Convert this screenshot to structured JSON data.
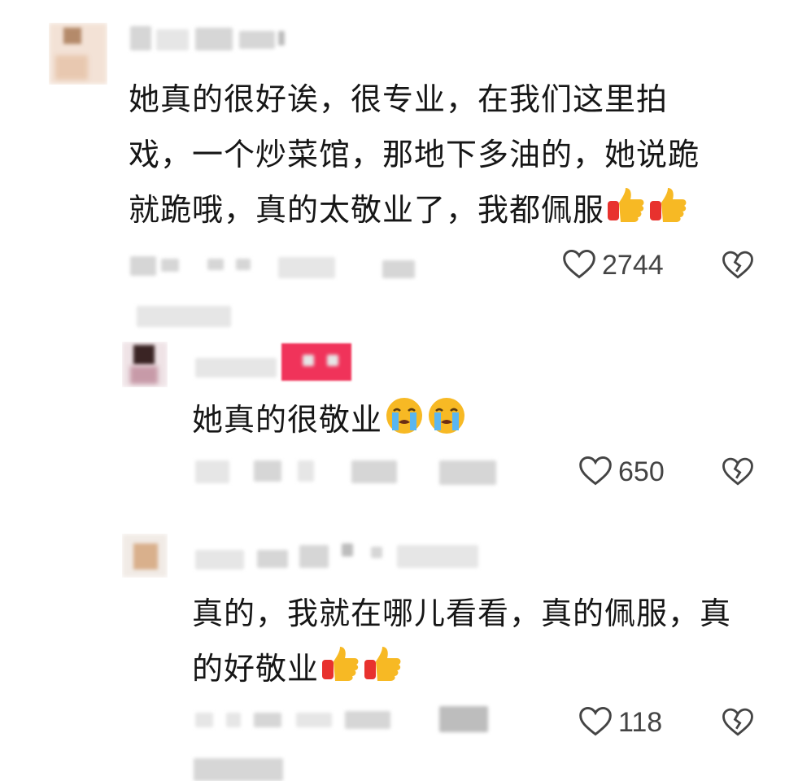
{
  "comments": [
    {
      "text": "她真的很好诶，很专业，在我们这里拍\n戏，一个炒菜馆，那地下多油的，她说跪\n就跪哦，真的太敬业了，我都佩服",
      "emoji": [
        "thumbs-up",
        "thumbs-up"
      ],
      "likes": "2744"
    },
    {
      "text": "她真的很敬业",
      "emoji": [
        "crying-face",
        "crying-face"
      ],
      "likes": "650"
    },
    {
      "text": "真的，我就在哪儿看看，真的佩服，真\n的好敬业",
      "emoji": [
        "thumbs-up",
        "thumbs-up"
      ],
      "likes": "118"
    }
  ],
  "icons": {
    "like": "heart-outline-icon",
    "dislike": "broken-heart-icon"
  },
  "colors": {
    "author_tag": "#f0335a",
    "emoji_yellow": "#f7b924",
    "emoji_red": "#e8322e"
  }
}
